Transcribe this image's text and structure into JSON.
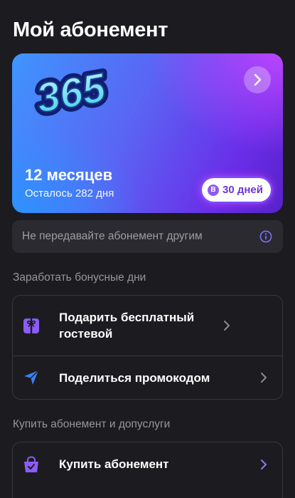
{
  "header": {
    "title": "Мой абонемент"
  },
  "subscription": {
    "logo_text": "365",
    "plan": "12 месяцев",
    "remaining": "Осталось 282 дня",
    "badge_mark": "B",
    "badge": "30 дней"
  },
  "notice": {
    "text": "Не передавайте абонемент другим"
  },
  "bonus_section": {
    "title": "Заработать бонусные дни",
    "items": [
      {
        "label": "Подарить бесплатный гостевой",
        "icon": "gift-icon"
      },
      {
        "label": "Поделиться промокодом",
        "icon": "paper-plane-icon"
      }
    ]
  },
  "buy_section": {
    "title": "Купить абонемент и допуслуги",
    "items": [
      {
        "label": "Купить абонемент",
        "icon": "shopping-bag-icon"
      }
    ]
  },
  "colors": {
    "background": "#1c1b1f",
    "accent_purple": "#8b5cf6",
    "accent_blue": "#3b82f6",
    "muted_text": "#97969c"
  }
}
